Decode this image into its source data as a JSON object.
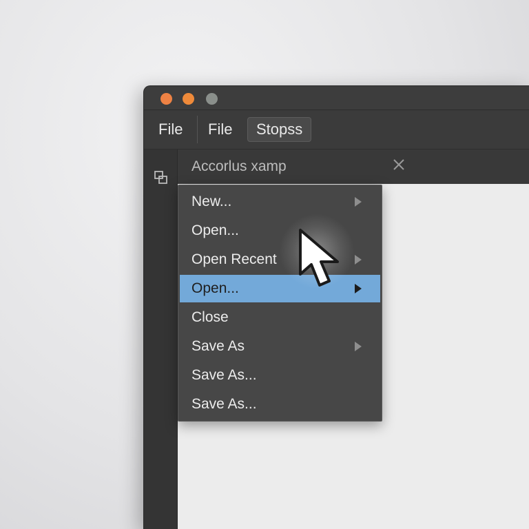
{
  "window": {
    "controls": [
      "close",
      "minimize",
      "zoom"
    ]
  },
  "menubar": {
    "items": [
      "File",
      "File",
      "Stopss"
    ]
  },
  "tab": {
    "title": "Accorlus xamp"
  },
  "icons": {
    "sidebar": "panel-layout-icon",
    "tab_close": "close-icon",
    "submenu": "chevron-right-icon",
    "cursor": "pointer-cursor-icon"
  },
  "dropdown": {
    "items": [
      {
        "label": "New...",
        "submenu": true
      },
      {
        "label": "Open...",
        "submenu": false
      },
      {
        "label": "Open Recent",
        "submenu": true
      },
      {
        "label": "Open...",
        "submenu": true,
        "highlighted": true
      },
      {
        "label": "Close",
        "submenu": false
      },
      {
        "label": "Save As",
        "submenu": true
      },
      {
        "label": "Save As...",
        "submenu": false
      },
      {
        "label": "Save As...",
        "submenu": false
      }
    ]
  },
  "colors": {
    "highlight": "#73a9d9",
    "traffic_red": "#ee8244",
    "traffic_yellow": "#ef8a3a",
    "traffic_grey": "#8a8f8b"
  }
}
